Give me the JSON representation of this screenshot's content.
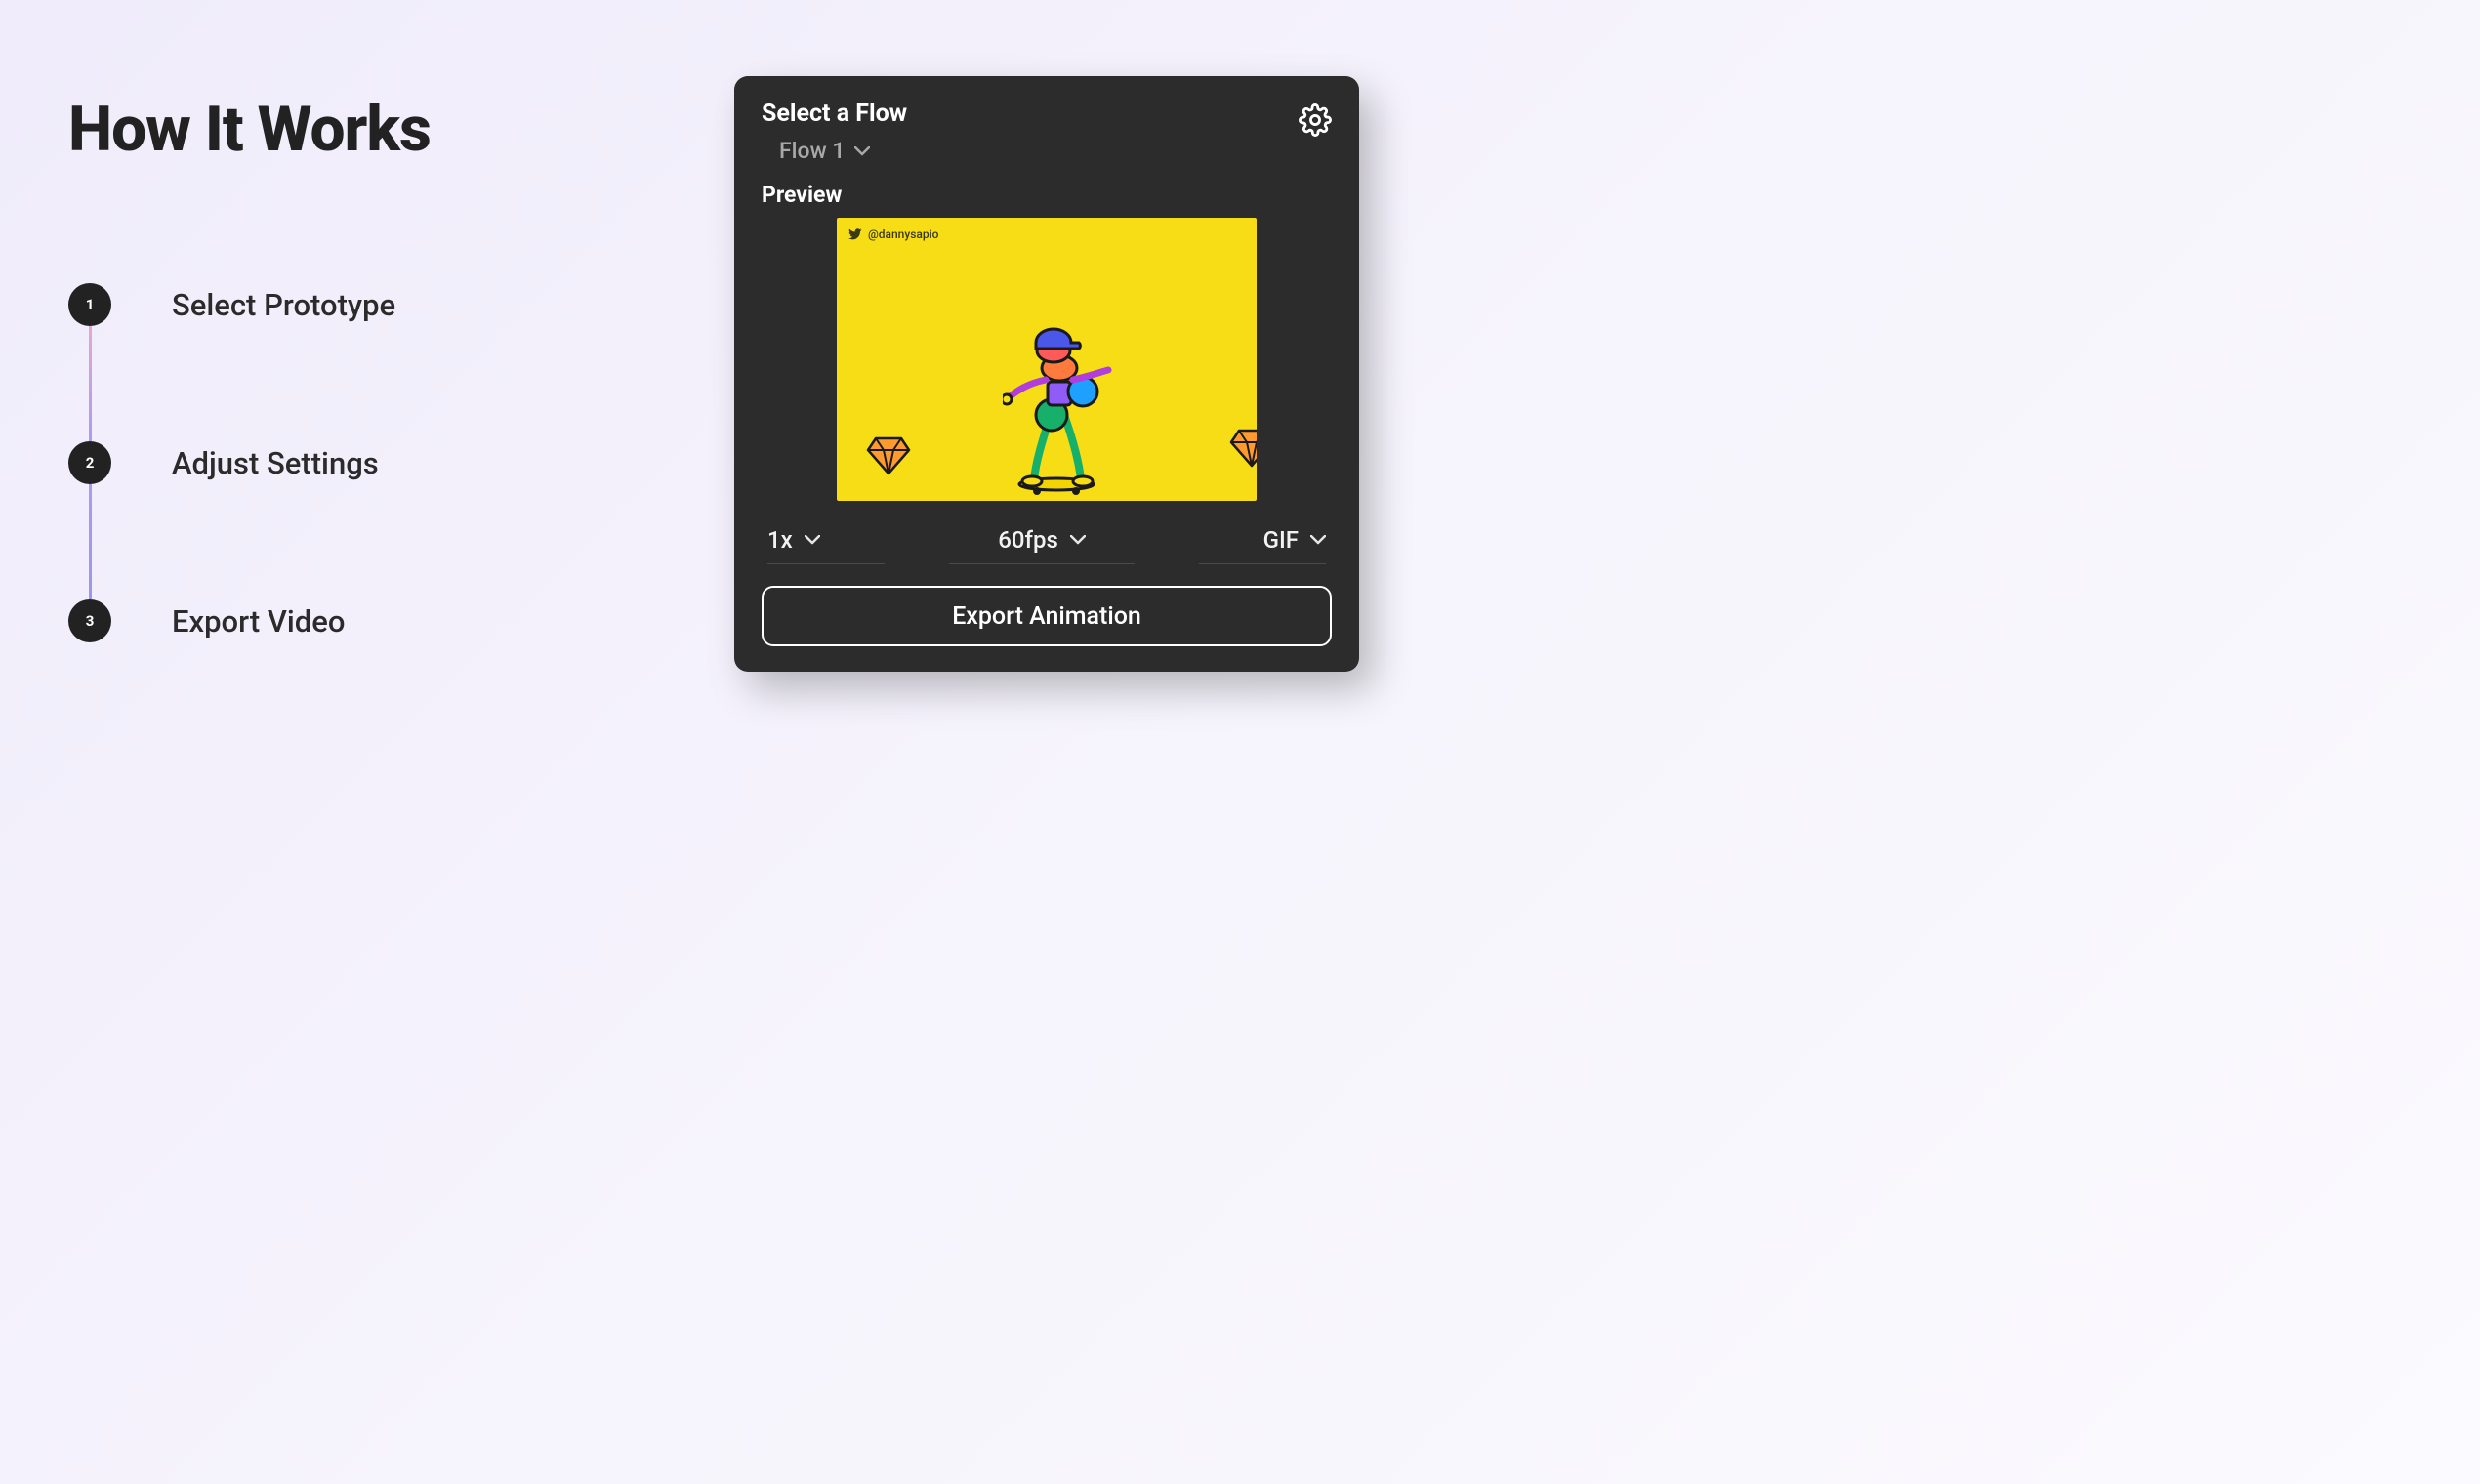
{
  "heading": "How It Works",
  "steps": [
    {
      "num": "1",
      "label": "Select Prototype"
    },
    {
      "num": "2",
      "label": "Adjust Settings"
    },
    {
      "num": "3",
      "label": "Export Video"
    }
  ],
  "panel": {
    "title": "Select a Flow",
    "flow_selected": "Flow 1",
    "preview_label": "Preview",
    "credit_handle": "@dannysapio",
    "controls": {
      "scale": "1x",
      "fps": "60fps",
      "format": "GIF"
    },
    "export_label": "Export Animation"
  }
}
